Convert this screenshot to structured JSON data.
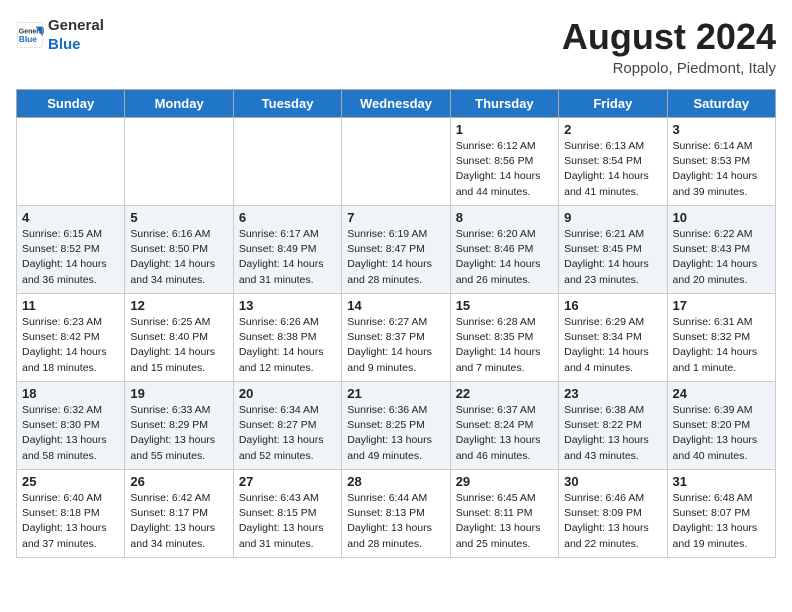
{
  "header": {
    "logo_general": "General",
    "logo_blue": "Blue",
    "month_year": "August 2024",
    "location": "Roppolo, Piedmont, Italy"
  },
  "days_of_week": [
    "Sunday",
    "Monday",
    "Tuesday",
    "Wednesday",
    "Thursday",
    "Friday",
    "Saturday"
  ],
  "weeks": [
    [
      {
        "day": "",
        "info": ""
      },
      {
        "day": "",
        "info": ""
      },
      {
        "day": "",
        "info": ""
      },
      {
        "day": "",
        "info": ""
      },
      {
        "day": "1",
        "info": "Sunrise: 6:12 AM\nSunset: 8:56 PM\nDaylight: 14 hours and 44 minutes."
      },
      {
        "day": "2",
        "info": "Sunrise: 6:13 AM\nSunset: 8:54 PM\nDaylight: 14 hours and 41 minutes."
      },
      {
        "day": "3",
        "info": "Sunrise: 6:14 AM\nSunset: 8:53 PM\nDaylight: 14 hours and 39 minutes."
      }
    ],
    [
      {
        "day": "4",
        "info": "Sunrise: 6:15 AM\nSunset: 8:52 PM\nDaylight: 14 hours and 36 minutes."
      },
      {
        "day": "5",
        "info": "Sunrise: 6:16 AM\nSunset: 8:50 PM\nDaylight: 14 hours and 34 minutes."
      },
      {
        "day": "6",
        "info": "Sunrise: 6:17 AM\nSunset: 8:49 PM\nDaylight: 14 hours and 31 minutes."
      },
      {
        "day": "7",
        "info": "Sunrise: 6:19 AM\nSunset: 8:47 PM\nDaylight: 14 hours and 28 minutes."
      },
      {
        "day": "8",
        "info": "Sunrise: 6:20 AM\nSunset: 8:46 PM\nDaylight: 14 hours and 26 minutes."
      },
      {
        "day": "9",
        "info": "Sunrise: 6:21 AM\nSunset: 8:45 PM\nDaylight: 14 hours and 23 minutes."
      },
      {
        "day": "10",
        "info": "Sunrise: 6:22 AM\nSunset: 8:43 PM\nDaylight: 14 hours and 20 minutes."
      }
    ],
    [
      {
        "day": "11",
        "info": "Sunrise: 6:23 AM\nSunset: 8:42 PM\nDaylight: 14 hours and 18 minutes."
      },
      {
        "day": "12",
        "info": "Sunrise: 6:25 AM\nSunset: 8:40 PM\nDaylight: 14 hours and 15 minutes."
      },
      {
        "day": "13",
        "info": "Sunrise: 6:26 AM\nSunset: 8:38 PM\nDaylight: 14 hours and 12 minutes."
      },
      {
        "day": "14",
        "info": "Sunrise: 6:27 AM\nSunset: 8:37 PM\nDaylight: 14 hours and 9 minutes."
      },
      {
        "day": "15",
        "info": "Sunrise: 6:28 AM\nSunset: 8:35 PM\nDaylight: 14 hours and 7 minutes."
      },
      {
        "day": "16",
        "info": "Sunrise: 6:29 AM\nSunset: 8:34 PM\nDaylight: 14 hours and 4 minutes."
      },
      {
        "day": "17",
        "info": "Sunrise: 6:31 AM\nSunset: 8:32 PM\nDaylight: 14 hours and 1 minute."
      }
    ],
    [
      {
        "day": "18",
        "info": "Sunrise: 6:32 AM\nSunset: 8:30 PM\nDaylight: 13 hours and 58 minutes."
      },
      {
        "day": "19",
        "info": "Sunrise: 6:33 AM\nSunset: 8:29 PM\nDaylight: 13 hours and 55 minutes."
      },
      {
        "day": "20",
        "info": "Sunrise: 6:34 AM\nSunset: 8:27 PM\nDaylight: 13 hours and 52 minutes."
      },
      {
        "day": "21",
        "info": "Sunrise: 6:36 AM\nSunset: 8:25 PM\nDaylight: 13 hours and 49 minutes."
      },
      {
        "day": "22",
        "info": "Sunrise: 6:37 AM\nSunset: 8:24 PM\nDaylight: 13 hours and 46 minutes."
      },
      {
        "day": "23",
        "info": "Sunrise: 6:38 AM\nSunset: 8:22 PM\nDaylight: 13 hours and 43 minutes."
      },
      {
        "day": "24",
        "info": "Sunrise: 6:39 AM\nSunset: 8:20 PM\nDaylight: 13 hours and 40 minutes."
      }
    ],
    [
      {
        "day": "25",
        "info": "Sunrise: 6:40 AM\nSunset: 8:18 PM\nDaylight: 13 hours and 37 minutes."
      },
      {
        "day": "26",
        "info": "Sunrise: 6:42 AM\nSunset: 8:17 PM\nDaylight: 13 hours and 34 minutes."
      },
      {
        "day": "27",
        "info": "Sunrise: 6:43 AM\nSunset: 8:15 PM\nDaylight: 13 hours and 31 minutes."
      },
      {
        "day": "28",
        "info": "Sunrise: 6:44 AM\nSunset: 8:13 PM\nDaylight: 13 hours and 28 minutes."
      },
      {
        "day": "29",
        "info": "Sunrise: 6:45 AM\nSunset: 8:11 PM\nDaylight: 13 hours and 25 minutes."
      },
      {
        "day": "30",
        "info": "Sunrise: 6:46 AM\nSunset: 8:09 PM\nDaylight: 13 hours and 22 minutes."
      },
      {
        "day": "31",
        "info": "Sunrise: 6:48 AM\nSunset: 8:07 PM\nDaylight: 13 hours and 19 minutes."
      }
    ]
  ]
}
